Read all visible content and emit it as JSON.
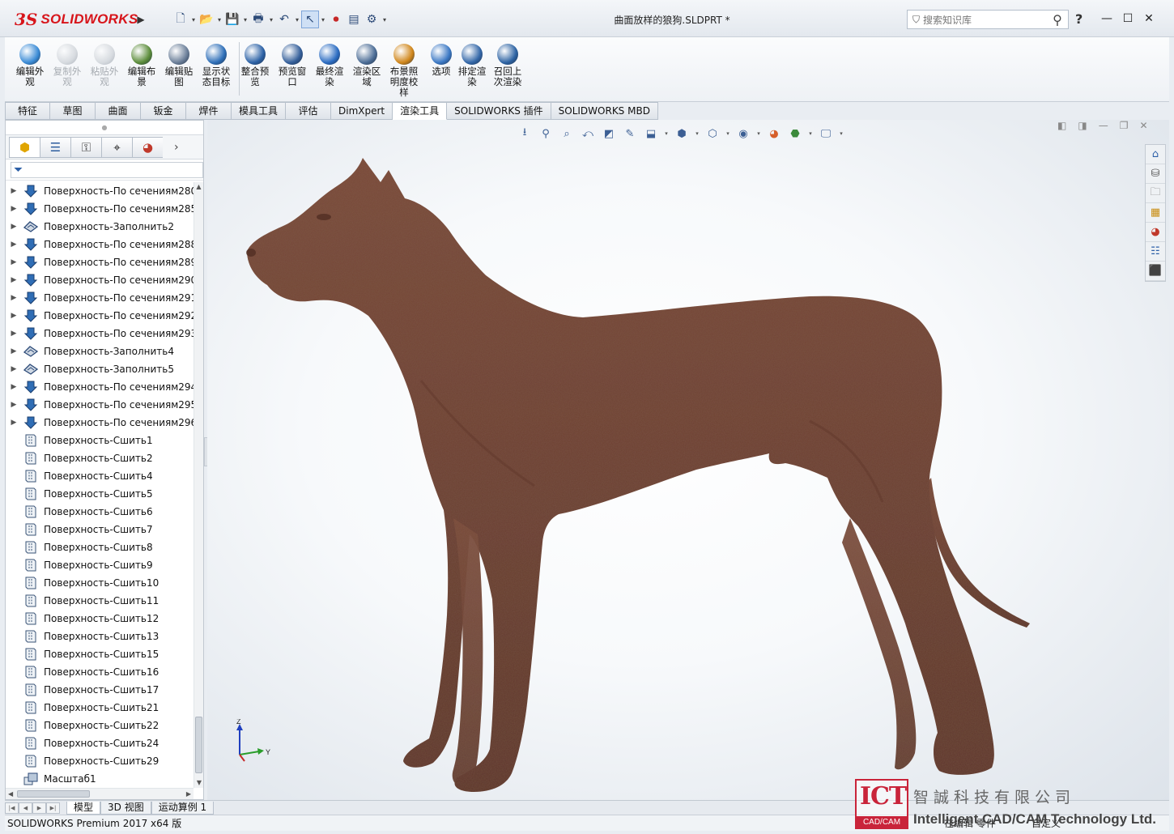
{
  "app": {
    "logo_ds": "3S",
    "logo_name": "SOLIDWORKS",
    "doc_title": "曲面放样的狼狗.SLDPRT *"
  },
  "search": {
    "placeholder": "搜索知识库"
  },
  "help": "?",
  "commands": [
    {
      "label": "编辑外\n观",
      "color": "#3a8bd6",
      "disabled": false
    },
    {
      "label": "复制外\n观",
      "color": "#9aa3ad",
      "disabled": true
    },
    {
      "label": "粘贴外\n观",
      "color": "#9aa3ad",
      "disabled": true
    },
    {
      "label": "编辑布\n景",
      "color": "#5b8c3a",
      "disabled": false
    },
    {
      "label": "编辑贴\n图",
      "color": "#6b7f99",
      "disabled": false
    },
    {
      "label": "显示状\n态目标",
      "color": "#2e6fb8",
      "disabled": false
    },
    {
      "label": "整合预\n览",
      "color": "#2c62a6",
      "disabled": false
    },
    {
      "label": "预览窗\n口",
      "color": "#345f9a",
      "disabled": false
    },
    {
      "label": "最终渲\n染",
      "color": "#2b6cc2",
      "disabled": false
    },
    {
      "label": "渲染区\n域",
      "color": "#4c6d96",
      "disabled": false
    },
    {
      "label": "布景照\n明度校\n样",
      "color": "#d0861a",
      "disabled": false
    },
    {
      "label": "选项",
      "color": "#3b78c4",
      "disabled": false
    },
    {
      "label": "排定渲\n染",
      "color": "#3367a8",
      "disabled": false
    },
    {
      "label": "召回上\n次渲染",
      "color": "#2d63a3",
      "disabled": false
    }
  ],
  "tabs": [
    "特征",
    "草图",
    "曲面",
    "钣金",
    "焊件",
    "模具工具",
    "评估",
    "DimXpert",
    "渲染工具",
    "SOLIDWORKS 插件",
    "SOLIDWORKS MBD"
  ],
  "active_tab": "渲染工具",
  "tree": [
    {
      "label": "Поверхность-По сечениям280",
      "type": "loft",
      "expand": true
    },
    {
      "label": "Поверхность-По сечениям285",
      "type": "loft",
      "expand": true
    },
    {
      "label": "Поверхность-Заполнить2",
      "type": "fill",
      "expand": true
    },
    {
      "label": "Поверхность-По сечениям288",
      "type": "loft",
      "expand": true
    },
    {
      "label": "Поверхность-По сечениям289",
      "type": "loft",
      "expand": true
    },
    {
      "label": "Поверхность-По сечениям290",
      "type": "loft",
      "expand": true
    },
    {
      "label": "Поверхность-По сечениям291",
      "type": "loft",
      "expand": true
    },
    {
      "label": "Поверхность-По сечениям292",
      "type": "loft",
      "expand": true
    },
    {
      "label": "Поверхность-По сечениям293",
      "type": "loft",
      "expand": true
    },
    {
      "label": "Поверхность-Заполнить4",
      "type": "fill",
      "expand": true
    },
    {
      "label": "Поверхность-Заполнить5",
      "type": "fill",
      "expand": true
    },
    {
      "label": "Поверхность-По сечениям294",
      "type": "loft",
      "expand": true
    },
    {
      "label": "Поверхность-По сечениям295",
      "type": "loft",
      "expand": true
    },
    {
      "label": "Поверхность-По сечениям296",
      "type": "loft",
      "expand": true
    },
    {
      "label": "Поверхность-Сшить1",
      "type": "knit",
      "expand": false
    },
    {
      "label": "Поверхность-Сшить2",
      "type": "knit",
      "expand": false
    },
    {
      "label": "Поверхность-Сшить4",
      "type": "knit",
      "expand": false
    },
    {
      "label": "Поверхность-Сшить5",
      "type": "knit",
      "expand": false
    },
    {
      "label": "Поверхность-Сшить6",
      "type": "knit",
      "expand": false
    },
    {
      "label": "Поверхность-Сшить7",
      "type": "knit",
      "expand": false
    },
    {
      "label": "Поверхность-Сшить8",
      "type": "knit",
      "expand": false
    },
    {
      "label": "Поверхность-Сшить9",
      "type": "knit",
      "expand": false
    },
    {
      "label": "Поверхность-Сшить10",
      "type": "knit",
      "expand": false
    },
    {
      "label": "Поверхность-Сшить11",
      "type": "knit",
      "expand": false
    },
    {
      "label": "Поверхность-Сшить12",
      "type": "knit",
      "expand": false
    },
    {
      "label": "Поверхность-Сшить13",
      "type": "knit",
      "expand": false
    },
    {
      "label": "Поверхность-Сшить15",
      "type": "knit",
      "expand": false
    },
    {
      "label": "Поверхность-Сшить16",
      "type": "knit",
      "expand": false
    },
    {
      "label": "Поверхность-Сшить17",
      "type": "knit",
      "expand": false
    },
    {
      "label": "Поверхность-Сшить21",
      "type": "knit",
      "expand": false
    },
    {
      "label": "Поверхность-Сшить22",
      "type": "knit",
      "expand": false
    },
    {
      "label": "Поверхность-Сшить24",
      "type": "knit",
      "expand": false
    },
    {
      "label": "Поверхность-Сшить29",
      "type": "knit",
      "expand": false
    },
    {
      "label": "Масштаб1",
      "type": "scale",
      "expand": false
    }
  ],
  "bottom_tabs": [
    "模型",
    "3D 视图",
    "运动算例 1"
  ],
  "active_bottom_tab": "模型",
  "status": {
    "app": "SOLIDWORKS Premium 2017 x64 版",
    "editing": "在编辑 零件",
    "custom": "自定义"
  },
  "triad": {
    "z": "Z",
    "y": "Y"
  },
  "watermark": {
    "logo": "ICT",
    "logo_sub": "CAD/CAM",
    "company_cn": "智誠科技有限公司",
    "company_en": "Intelligent CAD/CAM Technology Ltd."
  },
  "colors": {
    "brand_red": "#d7141a",
    "model_brown": "#6e4132",
    "accent_blue": "#2c5fa7"
  }
}
